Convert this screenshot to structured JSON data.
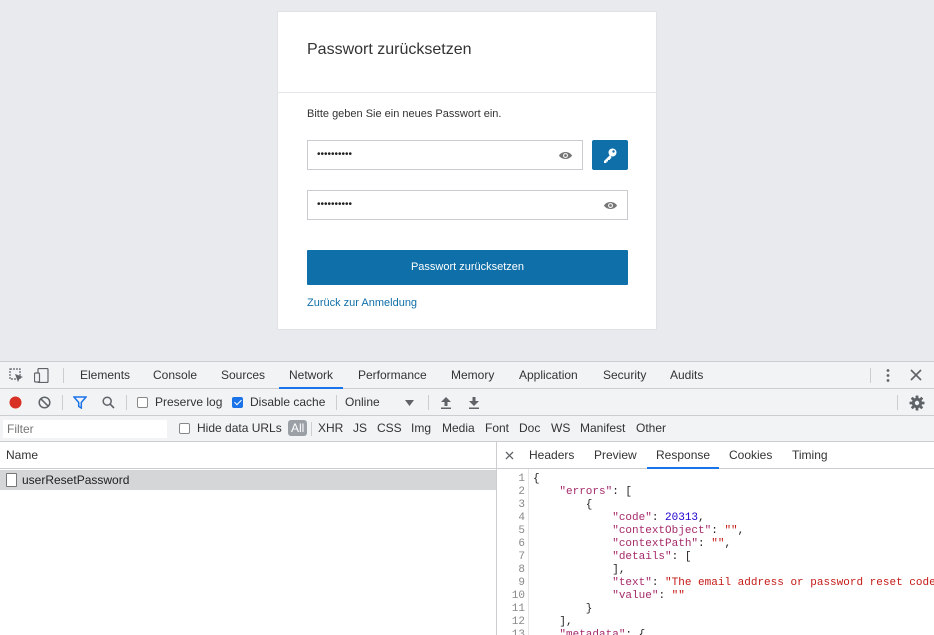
{
  "page": {
    "title": "Passwort zurücksetzen",
    "instruction": "Bitte geben Sie ein neues Passwort ein.",
    "password_value": "••••••••••",
    "confirm_value": "••••••••••",
    "submit_label": "Passwort zurücksetzen",
    "back_link": "Zurück zur Anmeldung",
    "accent_color": "#0f6fa8"
  },
  "devtools": {
    "tabs": [
      "Elements",
      "Console",
      "Sources",
      "Network",
      "Performance",
      "Memory",
      "Application",
      "Security",
      "Audits"
    ],
    "active_tab": "Network",
    "toolbar": {
      "preserve_log": "Preserve log",
      "disable_cache": "Disable cache",
      "throttle": "Online"
    },
    "filter": {
      "placeholder": "Filter",
      "hide_data_urls": "Hide data URLs",
      "types": [
        "All",
        "XHR",
        "JS",
        "CSS",
        "Img",
        "Media",
        "Font",
        "Doc",
        "WS",
        "Manifest",
        "Other"
      ]
    },
    "requests": {
      "column": "Name",
      "rows": [
        "userResetPassword"
      ]
    },
    "detail_tabs": [
      "Headers",
      "Preview",
      "Response",
      "Cookies",
      "Timing"
    ],
    "detail_active": "Response",
    "response_lines": [
      "{",
      "    \"errors\": [",
      "        {",
      "            \"code\": 20313,",
      "            \"contextObject\": \"\",",
      "            \"contextPath\": \"\",",
      "            \"details\": [",
      "            ],",
      "            \"text\": \"The email address or password reset code",
      "            \"value\": \"\"",
      "        }",
      "    ],",
      "    \"metadata\": {"
    ]
  }
}
